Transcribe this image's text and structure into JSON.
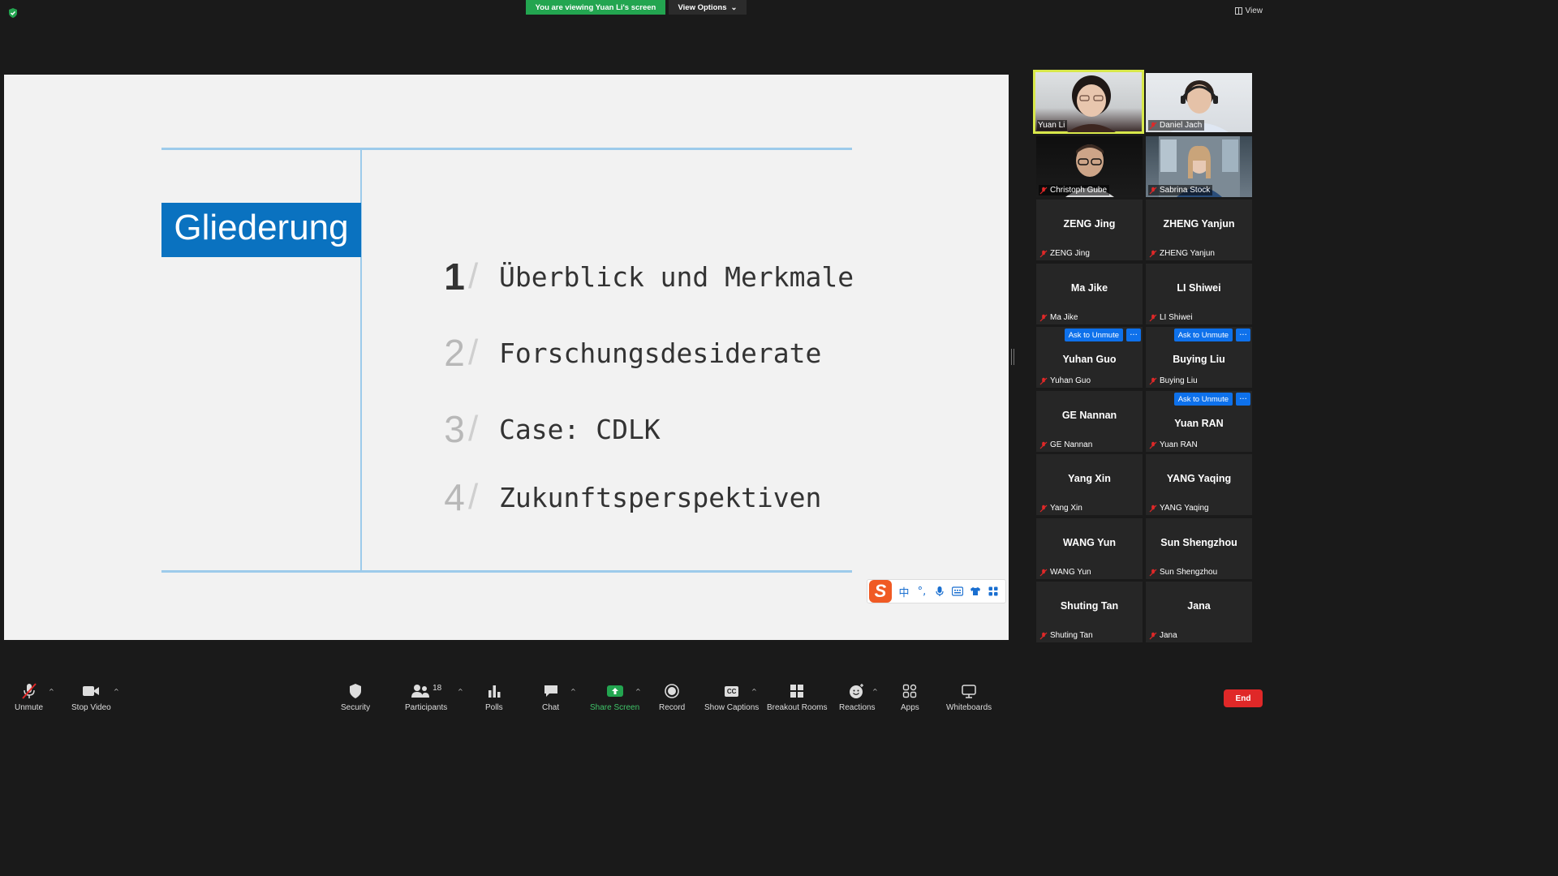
{
  "banner": {
    "viewing": "You are viewing Yuan Li's screen",
    "view_options": "View Options"
  },
  "top_right": {
    "view": "View"
  },
  "slide": {
    "heading": "Gliederung",
    "items": [
      {
        "num": "1",
        "text": "Überblick und Merkmale",
        "active": true
      },
      {
        "num": "2",
        "text": "Forschungsdesiderate",
        "active": false
      },
      {
        "num": "3",
        "text": "Case: CDLK",
        "active": false
      },
      {
        "num": "4",
        "text": "Zukunftsperspektiven",
        "active": false
      }
    ]
  },
  "ime": {
    "logo": "S",
    "lang": "中",
    "punct": "°,"
  },
  "gallery": {
    "ask_to_unmute": "Ask to Unmute",
    "more": "···",
    "participants": [
      {
        "name": "Yuan Li",
        "video": true,
        "muted": false
      },
      {
        "name": "Daniel Jach",
        "video": true,
        "muted": true
      },
      {
        "name": "Christoph Gube",
        "video": true,
        "muted": true
      },
      {
        "name": "Sabrina Stock",
        "video": true,
        "muted": true
      },
      {
        "name": "ZENG Jing",
        "video": false,
        "muted": true
      },
      {
        "name": "ZHENG Yanjun",
        "video": false,
        "muted": true
      },
      {
        "name": "Ma Jike",
        "video": false,
        "muted": true
      },
      {
        "name": "LI Shiwei",
        "video": false,
        "muted": true
      },
      {
        "name": "Yuhan Guo",
        "video": false,
        "muted": true
      },
      {
        "name": "Buying Liu",
        "video": false,
        "muted": true
      },
      {
        "name": "GE Nannan",
        "video": false,
        "muted": true
      },
      {
        "name": "Yuan RAN",
        "video": false,
        "muted": true
      },
      {
        "name": "Yang Xin",
        "video": false,
        "muted": true
      },
      {
        "name": "YANG Yaqing",
        "video": false,
        "muted": true
      },
      {
        "name": "WANG Yun",
        "video": false,
        "muted": true
      },
      {
        "name": "Sun Shengzhou",
        "video": false,
        "muted": true
      },
      {
        "name": "Shuting Tan",
        "video": false,
        "muted": true
      },
      {
        "name": "Jana",
        "video": false,
        "muted": true
      }
    ]
  },
  "toolbar": {
    "unmute": "Unmute",
    "stop_video": "Stop Video",
    "security": "Security",
    "participants": "Participants",
    "participants_count": "18",
    "polls": "Polls",
    "chat": "Chat",
    "share_screen": "Share Screen",
    "record": "Record",
    "show_captions": "Show Captions",
    "captions_icon": "CC",
    "breakout_rooms": "Breakout Rooms",
    "reactions": "Reactions",
    "apps": "Apps",
    "whiteboards": "Whiteboards",
    "end": "End"
  },
  "colors": {
    "share_green": "#23a550",
    "slide_blue": "#0a72c0",
    "ask_blue": "#0e71eb",
    "end_red": "#e02828",
    "active_speaker": "#d8e84a"
  }
}
